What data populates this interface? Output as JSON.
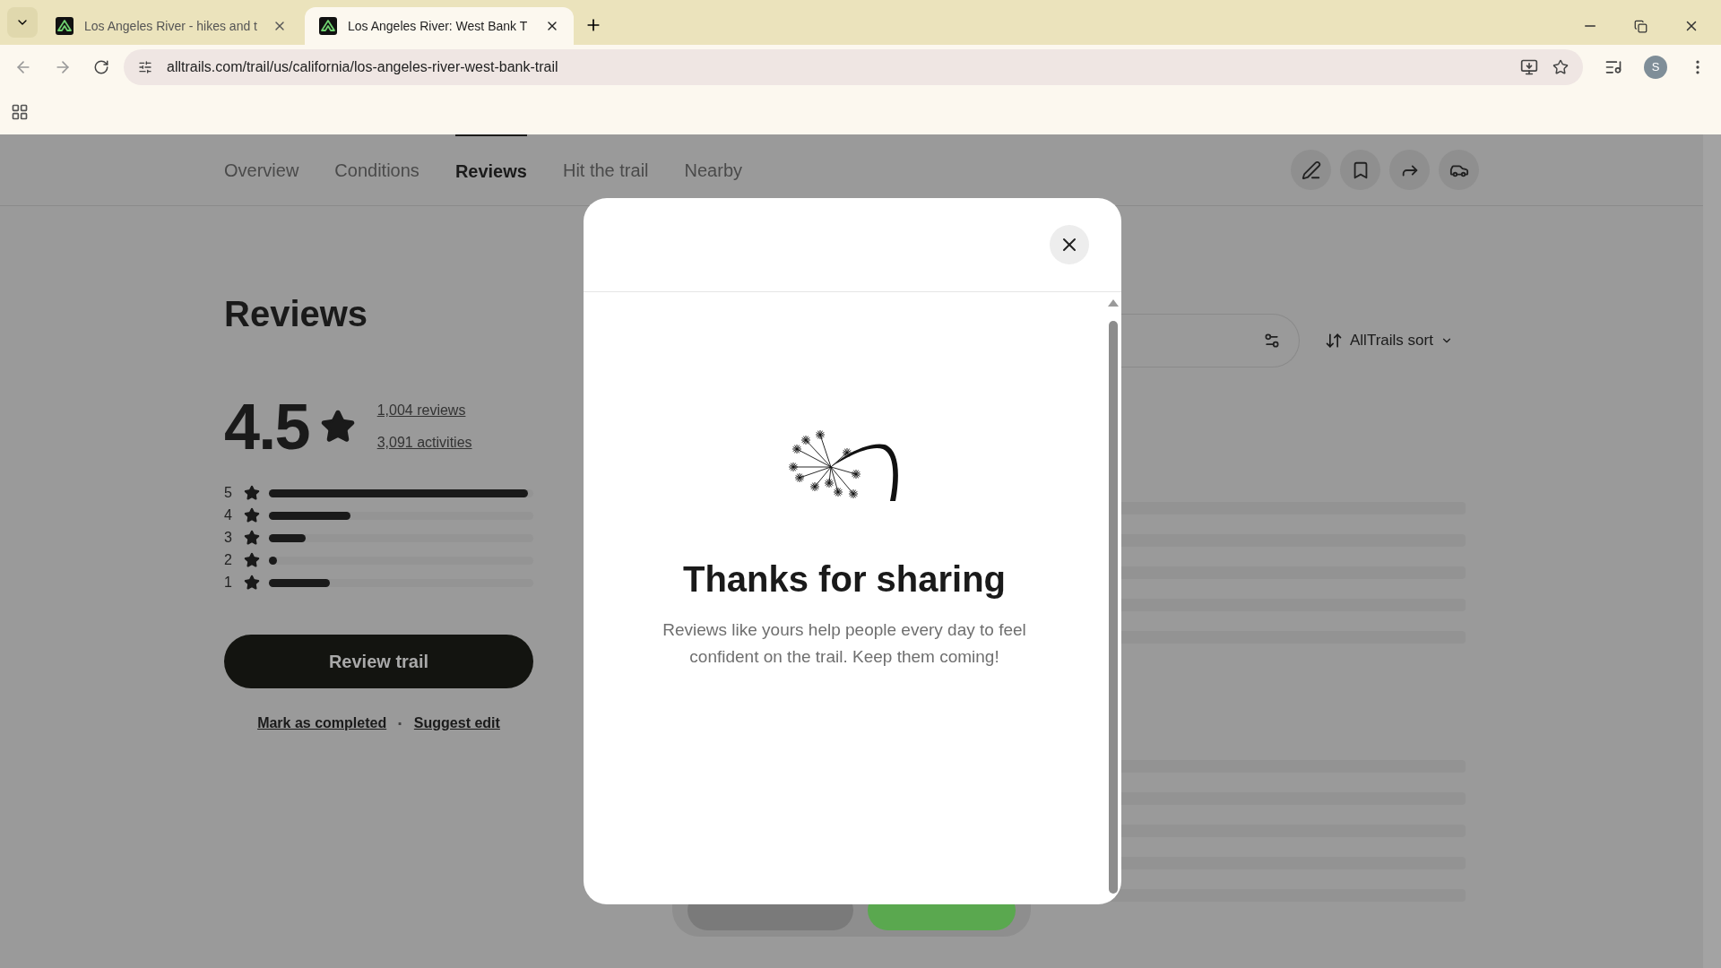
{
  "browser": {
    "tabs": [
      {
        "title": "Los Angeles River - hikes and t",
        "selected": false
      },
      {
        "title": "Los Angeles River: West Bank T",
        "selected": true
      }
    ],
    "url": "alltrails.com/trail/us/california/los-angeles-river-west-bank-trail",
    "profile_initial": "S"
  },
  "trail_nav": {
    "tabs": [
      {
        "label": "Overview",
        "selected": false
      },
      {
        "label": "Conditions",
        "selected": false
      },
      {
        "label": "Reviews",
        "selected": true
      },
      {
        "label": "Hit the trail",
        "selected": false
      },
      {
        "label": "Nearby",
        "selected": false
      }
    ]
  },
  "reviews": {
    "heading": "Reviews",
    "rating": "4.5",
    "review_count": "1,004 reviews",
    "activity_count": "3,091 activities",
    "breakdown": [
      {
        "stars_label": "5",
        "level": 0.98
      },
      {
        "stars_label": "4",
        "level": 0.31
      },
      {
        "stars_label": "3",
        "level": 0.14
      },
      {
        "stars_label": "2",
        "level": 0.03
      },
      {
        "stars_label": "1",
        "level": 0.23
      }
    ],
    "review_button": "Review trail",
    "links": [
      "Mark as completed",
      "Suggest edit"
    ],
    "link_separator": "·",
    "sort": "AllTrails sort"
  },
  "dialog": {
    "title": "Thanks for sharing",
    "message": "Reviews like yours help people every day to feel confident on the trail. Keep them coming!"
  }
}
